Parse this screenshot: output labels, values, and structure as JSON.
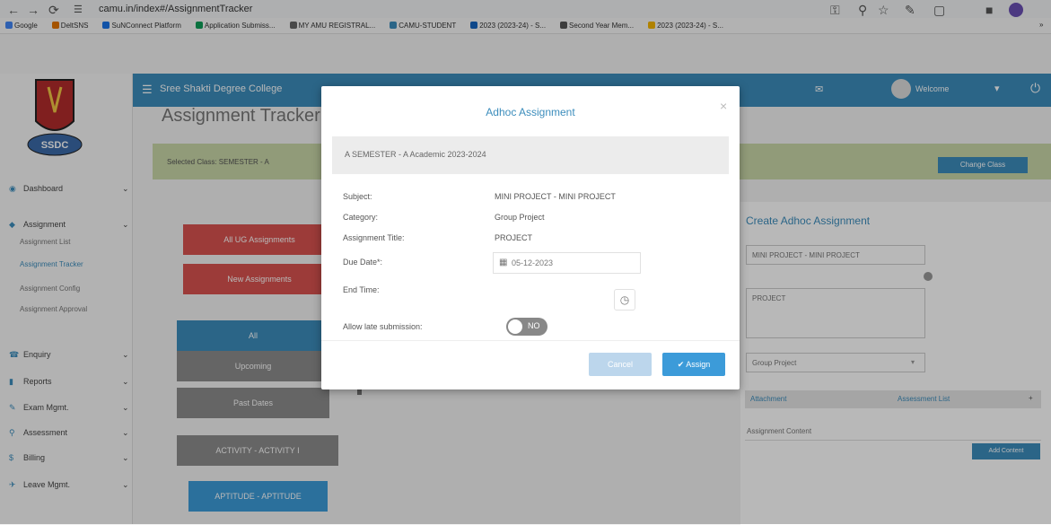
{
  "browser": {
    "url": "camu.in/index#/AssignmentTracker",
    "bookmarks": [
      {
        "label": "Google",
        "color": "#4285f4"
      },
      {
        "label": "DeltSNS",
        "color": "#e37400"
      },
      {
        "label": "SuNConnect Platform",
        "color": "#1a73e8"
      },
      {
        "label": "Application Submiss...",
        "color": "#0f9d58"
      },
      {
        "label": "MY AMU REGISTRAL...",
        "color": "#666666"
      },
      {
        "label": "CAMU-STUDENT",
        "color": "#3c8dbc"
      },
      {
        "label": "2023 (2023-24) - S...",
        "color": "#1565c0"
      },
      {
        "label": "Second Year Mem...",
        "color": "#555555"
      },
      {
        "label": "2023 (2023-24) - S...",
        "color": "#f4b400"
      }
    ]
  },
  "header": {
    "college_name": "Sree Shakti Degree College",
    "user_label": "Welcome"
  },
  "logo": {
    "text": "SSDC"
  },
  "sidebar": {
    "items": [
      {
        "label": "Dashboard",
        "icon": "tachometer-icon"
      },
      {
        "label": "Assignment",
        "icon": "book-icon"
      },
      {
        "label": "Enquiry",
        "icon": "phone-icon"
      },
      {
        "label": "Reports",
        "icon": "chart-icon"
      },
      {
        "label": "Exam Mgmt.",
        "icon": "pencil-icon"
      },
      {
        "label": "Assessment",
        "icon": "search-icon"
      },
      {
        "label": "Billing",
        "icon": "dollar-icon"
      },
      {
        "label": "Leave Mgmt.",
        "icon": "plane-icon"
      }
    ],
    "subitems": [
      "Assignment List",
      "Assignment Tracker",
      "Assignment Config",
      "Assignment Approval"
    ]
  },
  "page": {
    "title": "Assignment Tracker",
    "selected_class": "Selected Class: SEMESTER - A",
    "change_class": "Change Class",
    "buttons": [
      {
        "label": "All UG Assignments",
        "color": "#d9534f"
      },
      {
        "label": "New Assignments",
        "color": "#d9534f"
      },
      {
        "label": "All",
        "color": "#3c8dbc"
      },
      {
        "label": "Upcoming",
        "color": "#8c8c8c"
      },
      {
        "label": "Past Dates",
        "color": "#8c8c8c"
      },
      {
        "label": "ACTIVITY - ACTIVITY I",
        "color": "#8c8c8c"
      },
      {
        "label": "APTITUDE - APTITUDE",
        "color": "#3c9bd9"
      }
    ]
  },
  "right_panel": {
    "title": "Create Adhoc Assignment",
    "subject_select": "MINI PROJECT - MINI PROJECT",
    "title_value": "PROJECT",
    "category_select": "Group Project",
    "tab_attachment": "Attachment",
    "tab_assessment": "Assessment List",
    "content_label": "Assignment Content",
    "add_content": "Add Content"
  },
  "modal": {
    "title": "Adhoc Assignment",
    "banner": "A SEMESTER - A  Academic 2023-2024",
    "fields": [
      {
        "label": "Subject:",
        "value": "MINI PROJECT - MINI PROJECT"
      },
      {
        "label": "Category:",
        "value": "Group Project"
      },
      {
        "label": "Assignment Title:",
        "value": "PROJECT"
      },
      {
        "label": "Due Date*:",
        "value": "05-12-2023"
      },
      {
        "label": "End Time:",
        "value": ""
      }
    ],
    "late_label": "Allow late submission:",
    "toggle": "NO",
    "cancel": "Cancel",
    "assign": "Assign"
  }
}
